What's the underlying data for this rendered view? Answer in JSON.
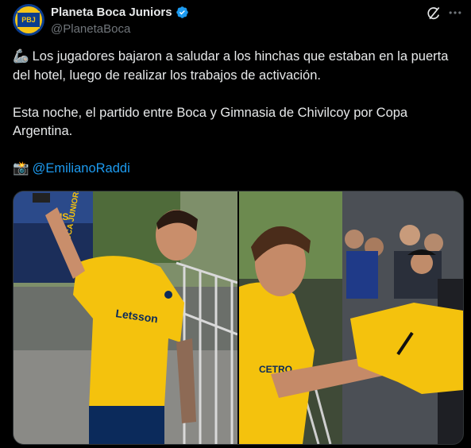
{
  "account": {
    "display_name": "Planeta Boca Juniors",
    "handle": "@PlanetaBoca",
    "avatar_text": "PBJ",
    "verified": true
  },
  "icons": {
    "verified": "verified-badge-icon",
    "grok": "grok-icon",
    "more": "more-options-icon",
    "emoji_1": "mechanical-arm-icon",
    "emoji_2": "camera-flash-icon"
  },
  "tweet": {
    "paragraph_1": "Los jugadores bajaron a saludar a los hinchas que estaban en la puerta del hotel, luego de realizar los trabajos de activación.",
    "paragraph_2": "Esta noche, el partido entre Boca y Gimnasia de Chivilcoy por Copa Argentina.",
    "mention": "@EmilianoRaddi"
  },
  "media": {
    "photo_1": {
      "bus_text": "BUS",
      "bus_text_2": "BOCA JUNIORS",
      "sponsor": "Letsson"
    },
    "photo_2": {
      "sponsor": "CETRO"
    }
  },
  "colors": {
    "background": "#000000",
    "text": "#e7e9ea",
    "muted": "#71767b",
    "link": "#1d9bf0",
    "boca_yellow": "#f4c20d",
    "boca_blue": "#0b2a5b"
  }
}
